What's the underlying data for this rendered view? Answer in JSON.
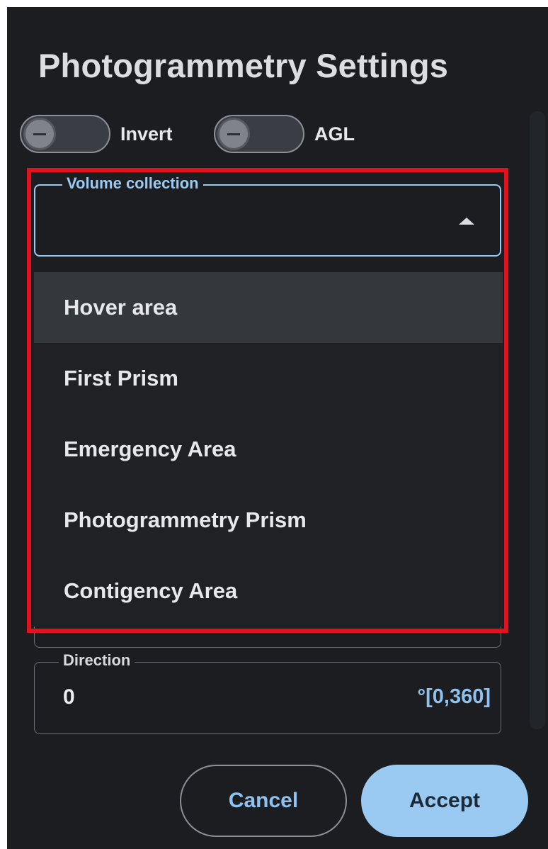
{
  "dialog": {
    "title": "Photogrammetry Settings"
  },
  "toggles": {
    "invert": {
      "label": "Invert",
      "checked": false
    },
    "agl": {
      "label": "AGL",
      "checked": false
    }
  },
  "volume_collection": {
    "label": "Volume collection",
    "value": "",
    "open": true,
    "options": [
      {
        "label": "Hover area",
        "hovered": true
      },
      {
        "label": "First Prism",
        "hovered": false
      },
      {
        "label": "Emergency Area",
        "hovered": false
      },
      {
        "label": "Photogrammetry Prism",
        "hovered": false
      },
      {
        "label": "Contigency Area",
        "hovered": false
      }
    ]
  },
  "direction": {
    "label": "Direction",
    "value": "0",
    "suffix": "°[0,360]"
  },
  "buttons": {
    "cancel": "Cancel",
    "accept": "Accept"
  },
  "colors": {
    "background": "#1b1d21",
    "accent": "#9ac9f2",
    "highlight": "#e3101d"
  }
}
